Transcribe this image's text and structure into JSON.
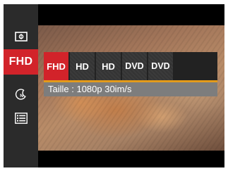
{
  "sidebar": {
    "items": [
      {
        "icon": "metering-frame-icon"
      },
      {
        "label": "FHD",
        "selected": true
      },
      {
        "icon": "night-mode-icon"
      },
      {
        "icon": "menu-list-icon"
      }
    ]
  },
  "resolution_options": [
    {
      "label": "FHD",
      "selected": true
    },
    {
      "label": "HD"
    },
    {
      "label": "HD"
    },
    {
      "label": "DVD"
    },
    {
      "label": "DVD"
    }
  ],
  "caption": "Taille : 1080p 30im/s",
  "colors": {
    "selected": "#d2232a",
    "accent_line": "#e39b1b",
    "sidebar": "#2b2b2b",
    "caption_bg": "#7d7d7d"
  }
}
